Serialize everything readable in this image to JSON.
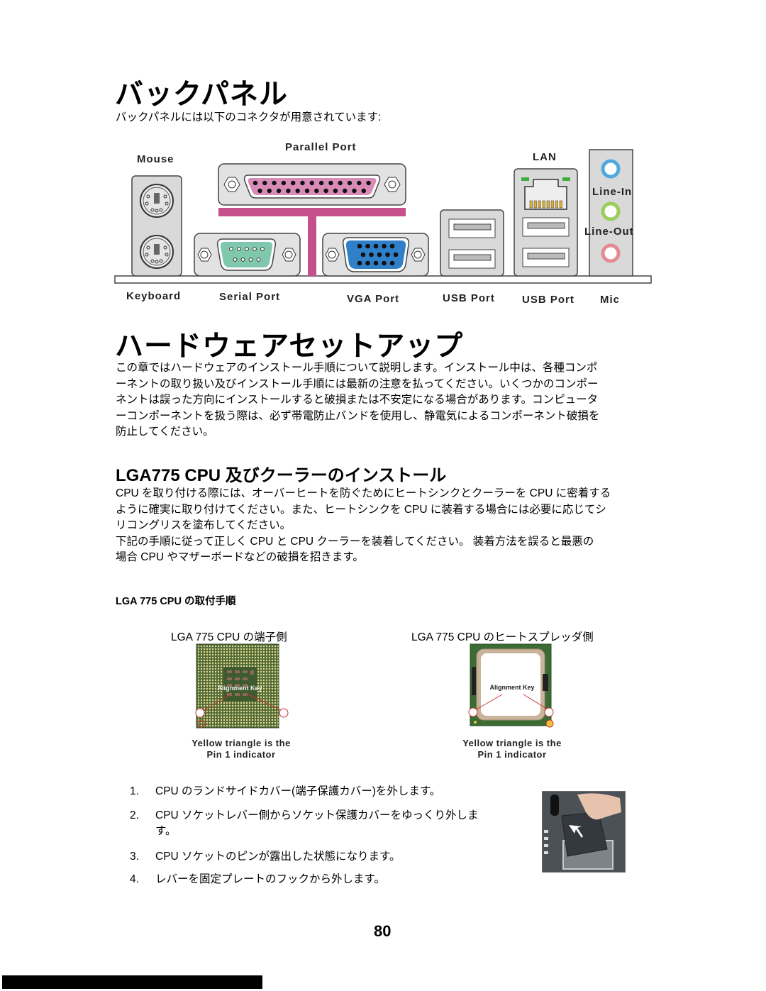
{
  "back_panel": {
    "title": "バックパネル",
    "intro": "バックパネルには以下のコネクタが用意されています:",
    "labels": {
      "mouse": "Mouse",
      "keyboard": "Keyboard",
      "parallel_port": "Parallel Port",
      "serial_port": "Serial Port",
      "vga_port": "VGA Port",
      "usb_port_1": "USB Port",
      "usb_port_2": "USB Port",
      "lan": "LAN",
      "line_in": "Line-In",
      "line_out": "Line-Out",
      "mic": "Mic"
    },
    "colors": {
      "parallel": "#d98bb8",
      "bracket": "#c5508c",
      "serial": "#7fc7ad",
      "vga": "#2f7fc9",
      "line_in_jack": "#4fa8de",
      "line_out_jack": "#9acd5a",
      "mic_jack": "#e38a94",
      "lan_led": "#3fae3f",
      "panel_gray": "#d9d9d9"
    }
  },
  "hardware_setup": {
    "title": "ハードウェアセットアップ",
    "lines": [
      "この章ではハードウェアのインストール手順について説明します。インストール中は、各種コンポ",
      "ーネントの取り扱い及びインストール手順には最新の注意を払ってください。いくつかのコンポー",
      "ネントは誤った方向にインストールすると破損または不安定になる場合があります。コンピュータ",
      "ーコンポーネントを扱う際は、必ず帯電防止バンドを使用し、静電気によるコンポーネント破損を",
      "防止してください。"
    ]
  },
  "cpu_section": {
    "title": "LGA775 CPU 及びクーラーのインストール",
    "lines": [
      "CPU を取り付ける際には、オーバーヒートを防ぐためにヒートシンクとクーラーを CPU に密着する",
      "ように確実に取り付けてください。また、ヒートシンクを CPU に装着する場合には必要に応じてシ",
      "リコングリスを塗布してください。",
      "下記の手順に従って正しく CPU と CPU クーラーを装着してください。 装着方法を誤ると最悪の",
      "場合 CPU やマザーボードなどの破損を招きます。"
    ],
    "procedure_heading": "LGA 775 CPU の取付手順",
    "figures": [
      {
        "caption": "LGA 775 CPU の端子側",
        "key_label": "Alignment Key",
        "note_line1": "Yellow triangle is the",
        "note_line2": "Pin 1 indicator"
      },
      {
        "caption": "LGA 775 CPU のヒートスプレッダ側",
        "key_label": "Alignment Key",
        "note_line1": "Yellow triangle is the",
        "note_line2": "Pin 1 indicator"
      }
    ],
    "steps": [
      {
        "num": "1.",
        "text": "CPU のランドサイドカバー(端子保護カバー)を外します。"
      },
      {
        "num": "2.",
        "text": "CPU ソケットレバー側からソケット保護カバーをゆっくり外します。"
      },
      {
        "num": "3.",
        "text": "CPU ソケットのピンが露出した状態になります。"
      },
      {
        "num": "4.",
        "text": "レバーを固定プレートのフックから外します。"
      }
    ]
  },
  "footer": {
    "page_number": "80"
  }
}
